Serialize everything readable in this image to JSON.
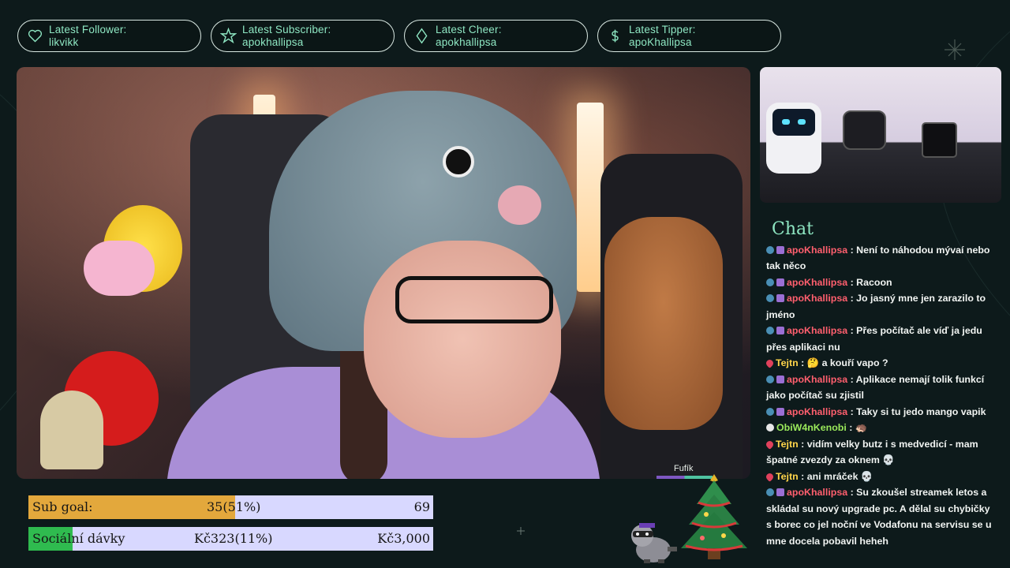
{
  "alerts": [
    {
      "label": "Latest Follower:",
      "value": "likvikk",
      "icon": "heart-icon"
    },
    {
      "label": "Latest Subscriber:",
      "value": "apokhallipsa",
      "icon": "star-icon"
    },
    {
      "label": "Latest Cheer:",
      "value": "apokhallipsa",
      "icon": "diamond-icon"
    },
    {
      "label": "Latest Tipper:",
      "value": "apoKhallipsa",
      "icon": "dollar-icon"
    }
  ],
  "camera": {
    "tag_name": "Fufík"
  },
  "chat": {
    "title": "Chat",
    "messages": [
      {
        "user": "apoKhallipsa",
        "text": ": Není to náhodou mývaí nebo tak něco"
      },
      {
        "user": "apoKhallipsa",
        "text": ": Racoon"
      },
      {
        "user": "apoKhallipsa",
        "text": ": Jo jasný mne jen zarazilo to jméno"
      },
      {
        "user": "apoKhallipsa",
        "text": ": Přes počítač ale víď ja jedu přes aplikaci nu"
      },
      {
        "user": "Tejtn",
        "text": ": 🤔 a kouří vapo ?"
      },
      {
        "user": "apoKhallipsa",
        "text": ": Aplikace nemají tolik funkcí jako počítač su zjistil"
      },
      {
        "user": "apoKhallipsa",
        "text": ": Taky si tu jedo mango vapik"
      },
      {
        "user": "ObiW4nKenobi",
        "text": ": 🦔"
      },
      {
        "user": "Tejtn",
        "text": ": vidím velky butz i s medvedicí - mam špatné zvezdy za oknem 💀"
      },
      {
        "user": "Tejtn",
        "text": ": ani mráček 💀"
      },
      {
        "user": "apoKhallipsa",
        "text": ": Su zkoušel streamek letos a skládal su nový upgrade pc. A dělal su chybičky s borec co jel noční ve Vodafonu na servisu se u mne docela pobavil heheh"
      }
    ]
  },
  "goals": {
    "sub": {
      "label": "Sub goal:",
      "current": "35(51%)",
      "target": "69",
      "progress": 0.51
    },
    "social": {
      "label": "Sociální dávky",
      "current": "Kč323(11%)",
      "target": "Kč3,000",
      "progress": 0.11
    }
  },
  "colors": {
    "accent": "#8ee6c2",
    "background": "#0d1a1b",
    "sub_fill": "#e3a83c",
    "social_fill": "#2fbb4f",
    "goal_track": "#d8d8ff"
  }
}
